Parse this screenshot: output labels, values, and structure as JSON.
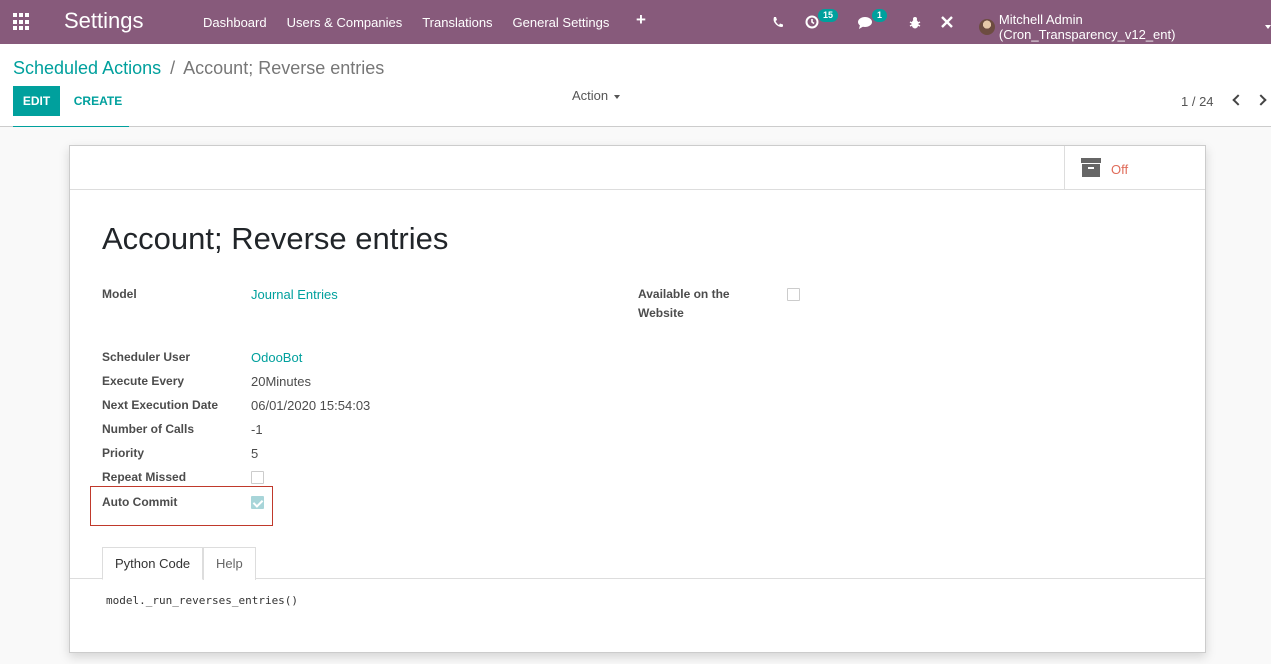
{
  "navbar": {
    "app_title": "Settings",
    "menu": [
      "Dashboard",
      "Users & Companies",
      "Translations",
      "General Settings"
    ],
    "activity_count": "15",
    "messages_count": "1",
    "user_name": "Mitchell Admin (Cron_Transparency_v12_ent)"
  },
  "breadcrumb": {
    "parent": "Scheduled Actions",
    "separator": "/",
    "current": "Account; Reverse entries"
  },
  "toolbar": {
    "edit_label": "EDIT",
    "create_label": "CREATE",
    "action_label": "Action",
    "pager_text": "1 / 24"
  },
  "archive": {
    "label": "Off"
  },
  "record": {
    "title": "Account; Reverse entries",
    "model_label": "Model",
    "model_value": "Journal Entries",
    "website_label_line1": "Available on the",
    "website_label_line2": "Website",
    "scheduler_user_label": "Scheduler User",
    "scheduler_user_value": "OdooBot",
    "execute_every_label": "Execute Every",
    "execute_every_value": "20Minutes",
    "next_execution_label": "Next Execution Date",
    "next_execution_value": "06/01/2020 15:54:03",
    "number_of_calls_label": "Number of Calls",
    "number_of_calls_value": "-1",
    "priority_label": "Priority",
    "priority_value": "5",
    "repeat_missed_label": "Repeat Missed",
    "auto_commit_label": "Auto Commit"
  },
  "tabs": {
    "python_code": "Python Code",
    "help": "Help"
  },
  "code": "model._run_reverses_entries()"
}
